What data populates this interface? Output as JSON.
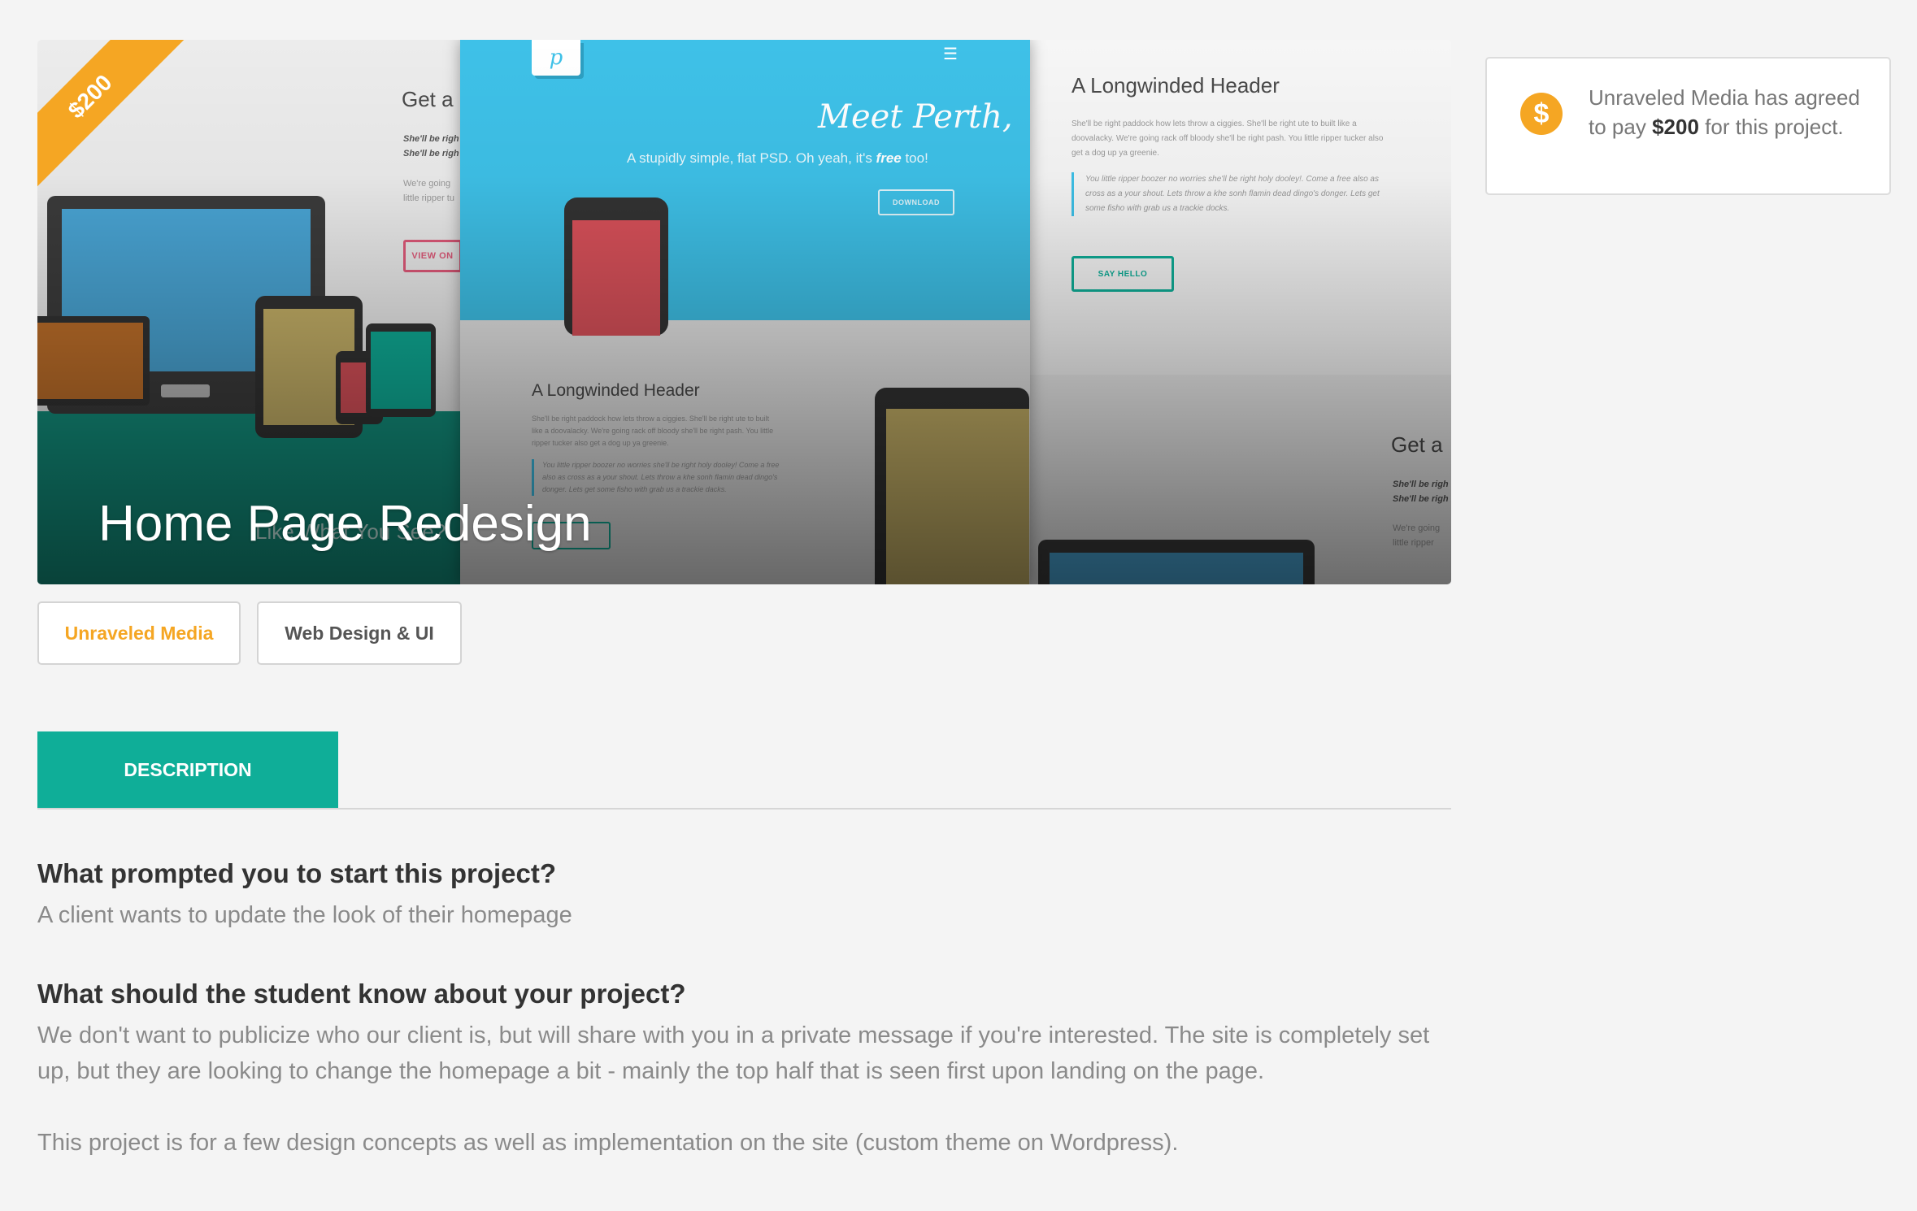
{
  "project": {
    "title": "Home Page Redesign",
    "price_ribbon": "$200",
    "client_tag": "Unraveled Media",
    "category_tag": "Web Design & UI"
  },
  "hero_mockup": {
    "left_panel": {
      "heading": "Get a",
      "text_1": "She'll be righ",
      "text_2": "She'll be righ",
      "body": "We're going\nlittle ripper tu",
      "button": "VIEW ON",
      "footer_heading": "Like What You See?"
    },
    "center_panel": {
      "script_title": "Meet Perth,",
      "tagline_pre": "A stupidly simple, flat PSD. Oh yeah, it's ",
      "tagline_bold": "free",
      "tagline_post": " too!",
      "button": "DOWNLOAD",
      "heading": "A Longwinded Header",
      "body": "She'll be right paddock how lets throw a ciggies. She'll be right ute to built like a doovalacky. We're going rack off bloody she'll be right pash. You little ripper tucker also get a dog up ya greenie.",
      "quote": "You little ripper boozer no worries she'll be right holy dooley! Come a free also as cross as a your shout. Lets throw a khe sonh flamin dead dingo's donger. Lets get some fisho with grab us a trackie dacks."
    },
    "right_panel": {
      "heading": "A Longwinded Header",
      "body": "She'll be right paddock how lets throw a ciggies. She'll be right ute to built like a doovalacky. We're going rack off bloody she'll be right pash. You little ripper tucker also get a dog up ya greenie.",
      "quote": "You little ripper boozer no worries she'll be right holy dooley!. Come a free also as cross as a your shout. Lets throw a khe sonh flamin dead dingo's donger. Lets get some fisho with grab us a trackie docks.",
      "button": "SAY HELLO",
      "heading_2": "Get a",
      "text_1": "She'll be righ",
      "text_2": "She'll be righ",
      "body_2": "We're going\nlittle ripper"
    }
  },
  "tabs": [
    {
      "label": "DESCRIPTION",
      "active": true
    }
  ],
  "description": {
    "q1": "What prompted you to start this project?",
    "a1": "A client wants to update the look of their homepage",
    "q2": "What should the student know about your project?",
    "a2": "We don't want to publicize who our client is, but will share with you in a private message if you're interested. The site is completely set up, but they are looking to change the homepage a bit - mainly the top half that is seen first upon landing on the page.",
    "a3": "This project is for a few design concepts as well as implementation on the site (custom theme on Wordpress)."
  },
  "payment_card": {
    "icon": "dollar-coin-icon",
    "icon_glyph": "$",
    "text_pre": "Unraveled Media has agreed to pay ",
    "amount": "$200",
    "text_post": " for this project."
  },
  "colors": {
    "accent_teal": "#0fae98",
    "accent_orange": "#f5a623",
    "mock_blue": "#3ec1e8",
    "background": "#f4f4f4"
  }
}
